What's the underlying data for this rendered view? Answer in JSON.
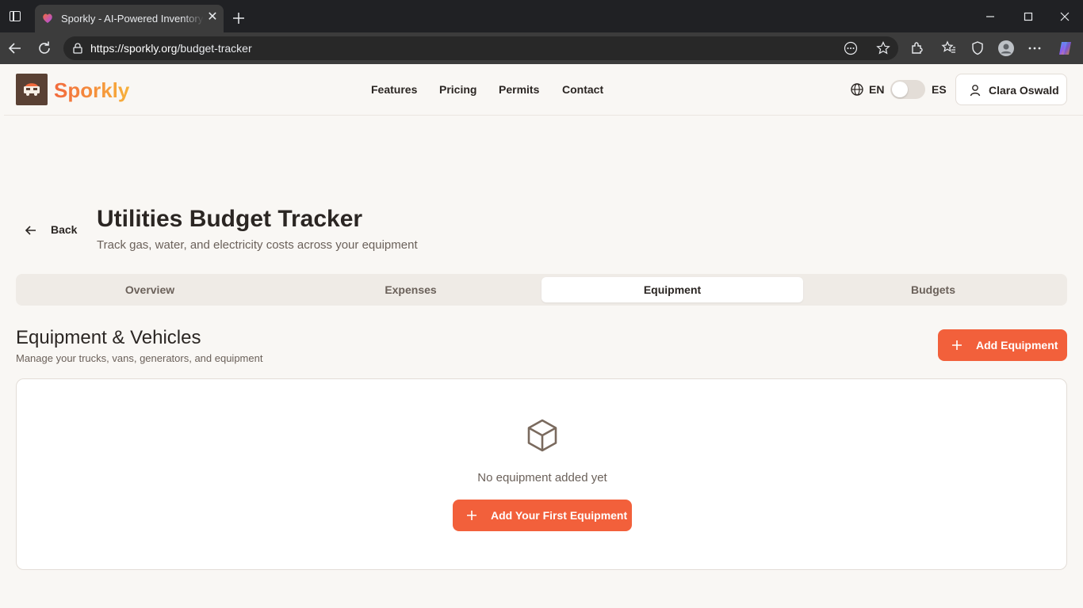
{
  "browser": {
    "tab_title": "Sporkly - AI-Powered Inventory Management",
    "url_host": "https://sporkly.org",
    "url_path": "/budget-tracker"
  },
  "header": {
    "brand": "Sporkly",
    "nav": [
      "Features",
      "Pricing",
      "Permits",
      "Contact"
    ],
    "lang_current": "EN",
    "lang_alt": "ES",
    "user_name": "Clara Oswald"
  },
  "page": {
    "back_label": "Back",
    "title": "Utilities Budget Tracker",
    "subtitle": "Track gas, water, and electricity costs across your equipment"
  },
  "tabs": [
    {
      "label": "Overview",
      "active": false
    },
    {
      "label": "Expenses",
      "active": false
    },
    {
      "label": "Equipment",
      "active": true
    },
    {
      "label": "Budgets",
      "active": false
    }
  ],
  "section": {
    "title": "Equipment & Vehicles",
    "subtitle": "Manage your trucks, vans, generators, and equipment",
    "add_button": "Add Equipment"
  },
  "empty_state": {
    "icon": "package-icon",
    "message": "No equipment added yet",
    "cta": "Add Your First Equipment"
  },
  "colors": {
    "accent": "#f2603b",
    "brand_gradient_start": "#f26a3d",
    "brand_gradient_end": "#f7b13b",
    "background": "#f9f7f4"
  }
}
